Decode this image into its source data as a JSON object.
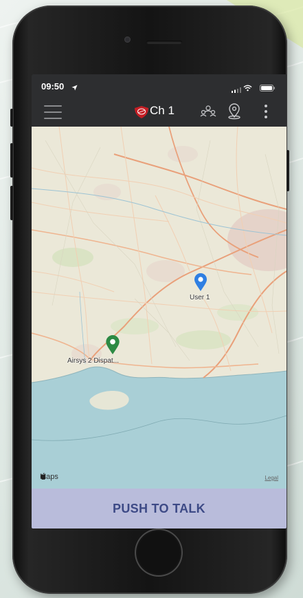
{
  "status_bar": {
    "time": "09:50",
    "location_arrow_icon": "location-arrow-icon",
    "signal_icon": "cellular-signal-icon",
    "wifi_icon": "wifi-icon",
    "battery_icon": "battery-icon"
  },
  "app_bar": {
    "menu_icon": "hamburger-menu-icon",
    "logo_icon": "shield-logo-icon",
    "channel": "Ch 1",
    "users_icon": "channel-users-icon",
    "location_icon": "location-pin-icon",
    "more_icon": "more-vertical-icon"
  },
  "map": {
    "markers": [
      {
        "label": "User 1",
        "color": "#2f7fe2"
      },
      {
        "label": "Airsys 2 Dispat...",
        "color": "#2d8a44"
      }
    ],
    "attribution": "Maps",
    "legal": "Legal"
  },
  "ptt_button": {
    "label": "PUSH TO TALK"
  },
  "colors": {
    "bar_background": "#2d2e30",
    "ptt_background": "#b9bcdb",
    "ptt_text": "#3d4a86",
    "sea": "#a9cfd6",
    "land": "#ebe8d8"
  }
}
